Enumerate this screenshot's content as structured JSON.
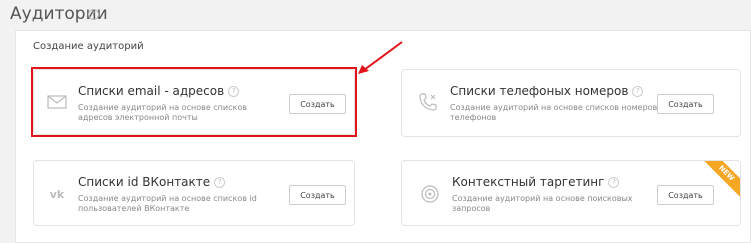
{
  "page": {
    "title": "Аудитории",
    "help_glyph": "?"
  },
  "section": {
    "title": "Создание аудиторий"
  },
  "cards": [
    {
      "name": "Списки email - адресов",
      "description": "Создание аудиторий на основе списков адресов электронной почты",
      "button": "Создать",
      "icon": "envelope-icon",
      "highlighted": true
    },
    {
      "name": "Списки телефоных номеров",
      "description": "Создание аудиторий на основе списков номеров телефонов",
      "button": "Создать",
      "icon": "phone-icon"
    },
    {
      "name": "Списки id ВКонтакте",
      "description": "Создание аудиторий на основе списков id пользователей ВКонтакте",
      "button": "Создать",
      "icon": "vk-logo-icon"
    },
    {
      "name": "Контекстный таргетинг",
      "description": "Создание аудиторий на основе поисковых запросов",
      "button": "Создать",
      "icon": "target-icon",
      "badge": "NEW"
    }
  ],
  "colors": {
    "highlight": "#e0141a",
    "badge": "#f5a623"
  }
}
